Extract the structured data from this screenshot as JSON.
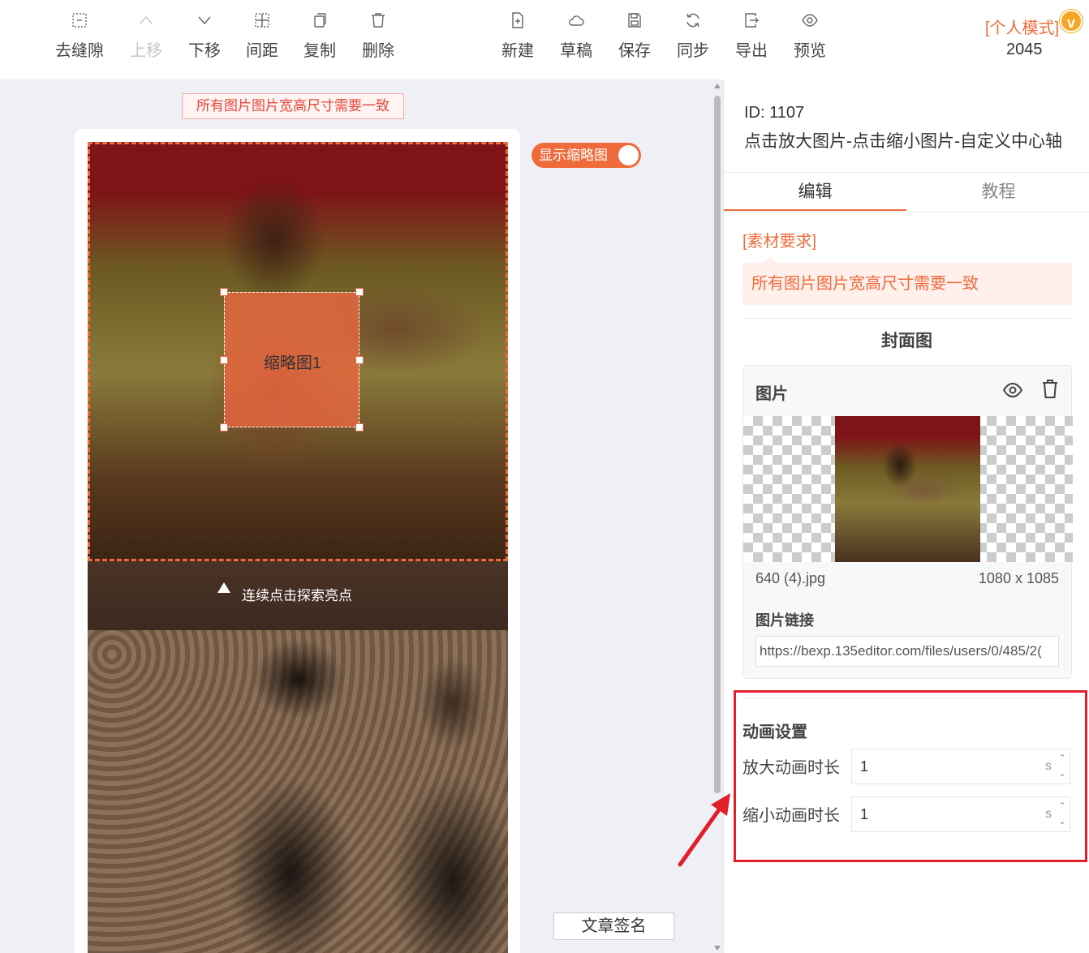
{
  "toolbar": {
    "left": [
      {
        "label": "去缝隙",
        "icon": "gap-icon",
        "disabled": false
      },
      {
        "label": "上移",
        "icon": "chevron-up-icon",
        "disabled": true
      },
      {
        "label": "下移",
        "icon": "chevron-down-icon",
        "disabled": false
      },
      {
        "label": "间距",
        "icon": "spacing-icon",
        "disabled": false
      },
      {
        "label": "复制",
        "icon": "copy-icon",
        "disabled": false
      },
      {
        "label": "删除",
        "icon": "trash-icon",
        "disabled": false
      }
    ],
    "right": [
      {
        "label": "新建",
        "icon": "new-file-icon"
      },
      {
        "label": "草稿",
        "icon": "cloud-icon"
      },
      {
        "label": "保存",
        "icon": "save-icon"
      },
      {
        "label": "同步",
        "icon": "sync-icon"
      },
      {
        "label": "导出",
        "icon": "export-icon"
      },
      {
        "label": "预览",
        "icon": "eye-icon"
      }
    ],
    "mode": "[个人模式]",
    "badge": "v",
    "count": "2045"
  },
  "canvas": {
    "notice": "所有图片图片宽高尺寸需要一致",
    "thumbnail_label": "缩略图1",
    "hint": "连续点击探索亮点",
    "toggle_label": "显示缩略图",
    "signature": "文章签名"
  },
  "panel": {
    "id": "ID: 1107",
    "title": "点击放大图片-点击缩小图片-自定义中心轴",
    "tabs": [
      {
        "label": "编辑",
        "active": true
      },
      {
        "label": "教程",
        "active": false
      }
    ],
    "requirement_title": "[素材要求]",
    "requirement_text": "所有图片图片宽高尺寸需要一致",
    "cover_title": "封面图",
    "image_card": {
      "title": "图片",
      "filename": "640 (4).jpg",
      "dimensions": "1080 x 1085",
      "link_label": "图片链接",
      "link_value": "https://bexp.135editor.com/files/users/0/485/2("
    },
    "animation": {
      "title": "动画设置",
      "zoom_in_label": "放大动画时长",
      "zoom_in_value": "1",
      "zoom_out_label": "缩小动画时长",
      "zoom_out_value": "1",
      "unit": "s"
    }
  },
  "colors": {
    "accent": "#f06b3c",
    "highlight": "#e01f2b"
  }
}
